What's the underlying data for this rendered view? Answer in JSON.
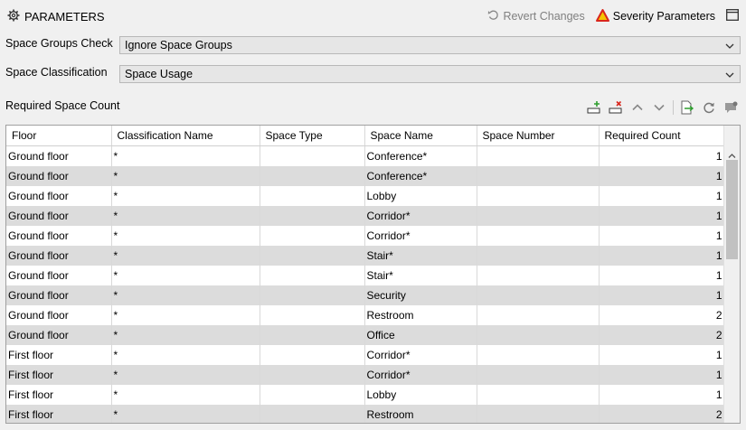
{
  "header": {
    "title": "PARAMETERS",
    "revert_label": "Revert Changes",
    "severity_label": "Severity Parameters"
  },
  "fields": {
    "space_groups_label": "Space Groups Check",
    "space_groups_value": "Ignore Space Groups",
    "classification_label": "Space Classification",
    "classification_value": "Space Usage"
  },
  "section_label": "Required Space Count",
  "table": {
    "columns": [
      "Floor",
      "Classification Name",
      "Space Type",
      "Space Name",
      "Space Number",
      "Required Count"
    ],
    "rows": [
      [
        "Ground floor",
        "*",
        "",
        "Conference*",
        "",
        "1"
      ],
      [
        "Ground floor",
        "*",
        "",
        "Conference*",
        "",
        "1"
      ],
      [
        "Ground floor",
        "*",
        "",
        "Lobby",
        "",
        "1"
      ],
      [
        "Ground floor",
        "*",
        "",
        "Corridor*",
        "",
        "1"
      ],
      [
        "Ground floor",
        "*",
        "",
        "Corridor*",
        "",
        "1"
      ],
      [
        "Ground floor",
        "*",
        "",
        "Stair*",
        "",
        "1"
      ],
      [
        "Ground floor",
        "*",
        "",
        "Stair*",
        "",
        "1"
      ],
      [
        "Ground floor",
        "*",
        "",
        "Security",
        "",
        "1"
      ],
      [
        "Ground floor",
        "*",
        "",
        "Restroom",
        "",
        "2"
      ],
      [
        "Ground floor",
        "*",
        "",
        "Office",
        "",
        "2"
      ],
      [
        "First floor",
        "*",
        "",
        "Corridor*",
        "",
        "1"
      ],
      [
        "First floor",
        "*",
        "",
        "Corridor*",
        "",
        "1"
      ],
      [
        "First floor",
        "*",
        "",
        "Lobby",
        "",
        "1"
      ],
      [
        "First floor",
        "*",
        "",
        "Restroom",
        "",
        "2"
      ]
    ]
  },
  "colors": {
    "alt_row": "#dcdcdc",
    "warning_red": "#d9261c",
    "warning_yellow": "#f5c400"
  },
  "icons": [
    "gear-icon",
    "revert-icon",
    "warning-triangle-icon",
    "window-icon",
    "chevron-down-icon",
    "add-row-icon",
    "delete-row-icon",
    "move-up-icon",
    "move-down-icon",
    "export-icon",
    "refresh-icon",
    "comment-icon"
  ]
}
